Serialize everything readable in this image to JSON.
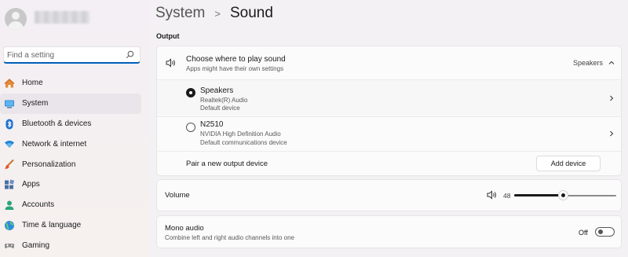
{
  "user": {
    "name": ""
  },
  "search": {
    "placeholder": "Find a setting"
  },
  "nav": [
    {
      "label": "Home",
      "icon": "home-icon",
      "active": false
    },
    {
      "label": "System",
      "icon": "system-icon",
      "active": true
    },
    {
      "label": "Bluetooth & devices",
      "icon": "bluetooth-icon",
      "active": false
    },
    {
      "label": "Network & internet",
      "icon": "wifi-icon",
      "active": false
    },
    {
      "label": "Personalization",
      "icon": "brush-icon",
      "active": false
    },
    {
      "label": "Apps",
      "icon": "apps-icon",
      "active": false
    },
    {
      "label": "Accounts",
      "icon": "accounts-icon",
      "active": false
    },
    {
      "label": "Time & language",
      "icon": "globe-icon",
      "active": false
    },
    {
      "label": "Gaming",
      "icon": "gamepad-icon",
      "active": false
    }
  ],
  "header": {
    "parent": "System",
    "separator": ">",
    "title": "Sound"
  },
  "output": {
    "section_label": "Output",
    "choose": {
      "title": "Choose where to play sound",
      "subtitle": "Apps might have their own settings",
      "selected": "Speakers"
    },
    "devices": [
      {
        "name": "Speakers",
        "detail": "Realtek(R) Audio",
        "status": "Default device",
        "selected": true
      },
      {
        "name": "N2510",
        "detail": "NVIDIA High Definition Audio",
        "status": "Default communications device",
        "selected": false
      }
    ],
    "pair": {
      "label": "Pair a new output device",
      "button": "Add device"
    }
  },
  "volume": {
    "label": "Volume",
    "value": "48",
    "level": 48
  },
  "mono": {
    "title": "Mono audio",
    "subtitle": "Combine left and right audio channels into one",
    "state": "Off"
  },
  "colors": {
    "accent": "#005fb8",
    "text": "#1b1b1b",
    "sidebar_active": "#e9e5ea"
  }
}
